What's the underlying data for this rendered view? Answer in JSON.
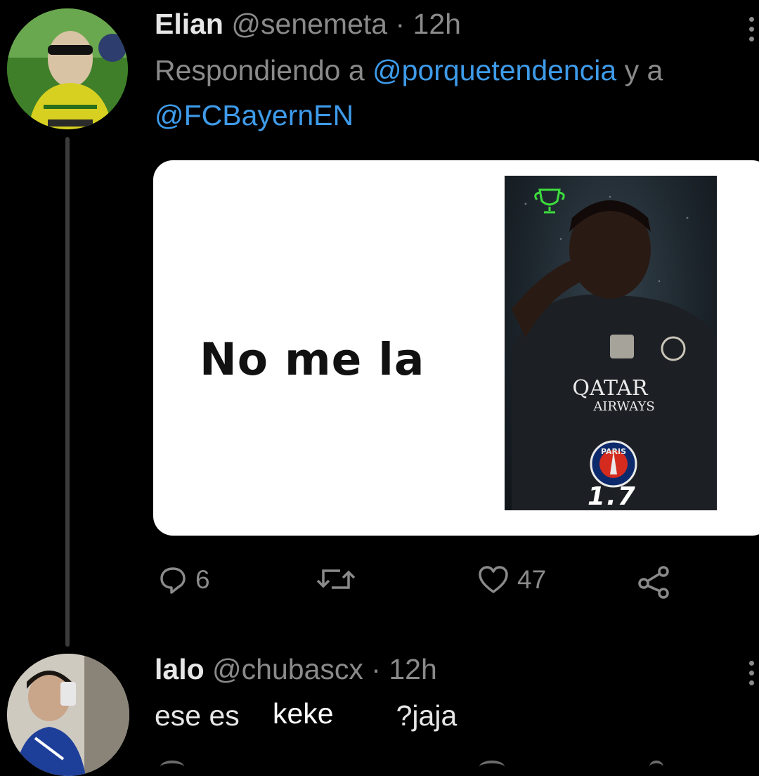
{
  "tweet": {
    "display_name": "Elian",
    "handle": "@senemeta",
    "separator": "·",
    "time": "12h",
    "replying_prefix": "Respondiendo a",
    "mention_1": "@porquetendencia",
    "replying_joiner": "y a",
    "mention_2": "@FCBayernEN",
    "media": {
      "meme_text": "No me la",
      "jersey_sponsor_line1": "QATAR",
      "jersey_sponsor_line2": "AIRWAYS",
      "badge_text": "PARIS",
      "rating": "1.7"
    },
    "actions": {
      "reply_icon": "speech-bubble-icon",
      "reply_count": "6",
      "retweet_icon": "retweet-icon",
      "like_icon": "heart-icon",
      "like_count": "47",
      "share_icon": "share-icon"
    }
  },
  "reply": {
    "display_name": "lalo",
    "handle": "@chubascx",
    "separator": "·",
    "time": "12h",
    "body_start": "ese es",
    "overlay_word": "keke",
    "body_end": "?jaja"
  },
  "colors": {
    "background": "#000000",
    "link": "#3e9be9",
    "muted": "#8a8a8a"
  }
}
